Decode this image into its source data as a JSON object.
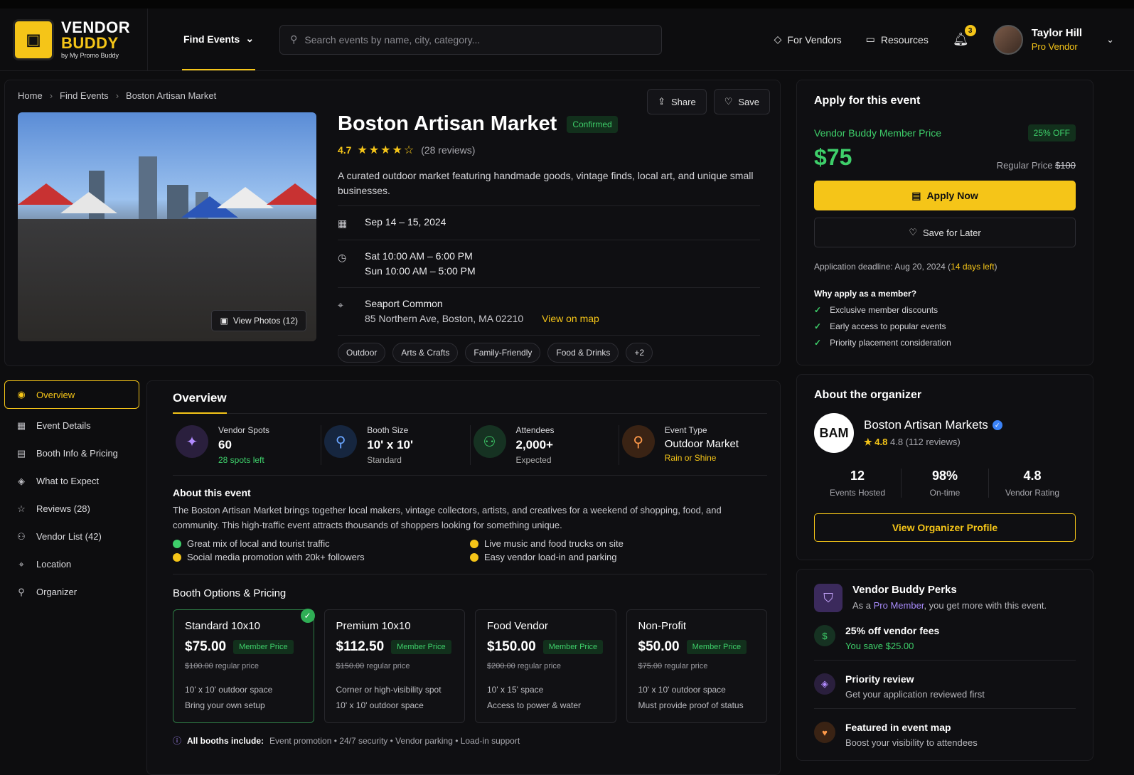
{
  "brand": {
    "line1": "VENDOR",
    "line2": "BUDDY",
    "tagline": "by My Promo Buddy"
  },
  "nav": {
    "find_events": "Find Events",
    "for_vendors": "For Vendors",
    "resources": "Resources",
    "notification_count": "3"
  },
  "search": {
    "placeholder": "Search events by name, city, category..."
  },
  "user": {
    "name": "Taylor Hill",
    "role": "Pro Vendor"
  },
  "breadcrumb": [
    "Home",
    "Find Events",
    "Boston Artisan Market"
  ],
  "actions": {
    "share": "Share",
    "save": "Save"
  },
  "event": {
    "title": "Boston Artisan Market",
    "status": "Confirmed",
    "rating": "4.7",
    "reviews": "(28 reviews)",
    "description": "A curated outdoor market featuring handmade goods, vintage finds, local art, and unique small businesses.",
    "dates": "Sep 14 – 15, 2024",
    "time_sat": "Sat 10:00 AM – 6:00 PM",
    "time_sun": "Sun 10:00 AM – 5:00 PM",
    "venue": "Seaport Common",
    "address": "85 Northern Ave, Boston, MA 02210",
    "view_map": "View on map",
    "view_photos": "View Photos (12)",
    "tags": [
      "Outdoor",
      "Arts & Crafts",
      "Family-Friendly",
      "Food & Drinks",
      "+2"
    ]
  },
  "sidenav": [
    "Overview",
    "Event Details",
    "Booth Info & Pricing",
    "What to Expect",
    "Reviews (28)",
    "Vendor List (42)",
    "Location",
    "Organizer"
  ],
  "overview": {
    "title": "Overview",
    "stats": [
      {
        "label": "Vendor Spots",
        "value": "60",
        "sub": "28 spots left"
      },
      {
        "label": "Booth Size",
        "value": "10' x 10'",
        "sub": "Standard"
      },
      {
        "label": "Attendees",
        "value": "2,000+",
        "sub": "Expected"
      },
      {
        "label": "Event Type",
        "value": "Outdoor Market",
        "sub": "Rain or Shine"
      }
    ],
    "about_title": "About this event",
    "about_text": "The Boston Artisan Market brings together local makers, vintage collectors, artists, and creatives for a weekend of shopping, food, and community. This high-traffic event attracts thousands of shoppers looking for something unique.",
    "bullets": [
      "Great mix of local and tourist traffic",
      "Live music and food trucks on site",
      "Social media promotion with 20k+ followers",
      "Easy vendor load-in and parking"
    ]
  },
  "booths": {
    "title": "Booth Options & Pricing",
    "member_tag": "Member Price",
    "regular_suffix": "regular price",
    "items": [
      {
        "name": "Standard 10x10",
        "price": "$75.00",
        "regular": "$100.00",
        "d1": "10' x 10' outdoor space",
        "d2": "Bring your own setup"
      },
      {
        "name": "Premium 10x10",
        "price": "$112.50",
        "regular": "$150.00",
        "d1": "Corner or high-visibility spot",
        "d2": "10' x 10' outdoor space"
      },
      {
        "name": "Food Vendor",
        "price": "$150.00",
        "regular": "$200.00",
        "d1": "10' x 15' space",
        "d2": "Access to power & water"
      },
      {
        "name": "Non-Profit",
        "price": "$50.00",
        "regular": "$75.00",
        "d1": "10' x 10' outdoor space",
        "d2": "Must provide proof of status"
      }
    ],
    "include_label": "All booths include:",
    "includes": "Event promotion  •  24/7 security  •  Vendor parking  •  Load-in support"
  },
  "apply": {
    "title": "Apply for this event",
    "member_label": "Vendor Buddy Member Price",
    "discount": "25% OFF",
    "price": "$75",
    "regular_label": "Regular Price",
    "regular_price": "$100",
    "apply_btn": "Apply Now",
    "save_btn": "Save for Later",
    "deadline_text": "Application deadline: Aug 20, 2024 (",
    "deadline_left": "14 days left",
    "deadline_close": ")",
    "why_title": "Why apply as a member?",
    "why": [
      "Exclusive member discounts",
      "Early access to popular events",
      "Priority placement consideration"
    ]
  },
  "organizer": {
    "title": "About the organizer",
    "initials": "BAM",
    "name": "Boston Artisan Markets",
    "rating": "4.8",
    "rating_text": "4.8 (112 reviews)",
    "stats": [
      {
        "value": "12",
        "label": "Events Hosted"
      },
      {
        "value": "98%",
        "label": "On-time"
      },
      {
        "value": "4.8",
        "label": "Vendor Rating"
      }
    ],
    "button": "View Organizer Profile"
  },
  "perks": {
    "title": "Vendor Buddy Perks",
    "sub_pre": "As a ",
    "sub_link": "Pro Member",
    "sub_post": ", you get more with this event.",
    "items": [
      {
        "title": "25% off vendor fees",
        "sub": "You save $25.00"
      },
      {
        "title": "Priority review",
        "sub": "Get your application reviewed first"
      },
      {
        "title": "Featured in event map",
        "sub": "Boost your visibility to attendees"
      }
    ]
  },
  "colors": {
    "accent": "#f5c518",
    "success": "#3ecf6a",
    "background": "#0d0d0f"
  }
}
